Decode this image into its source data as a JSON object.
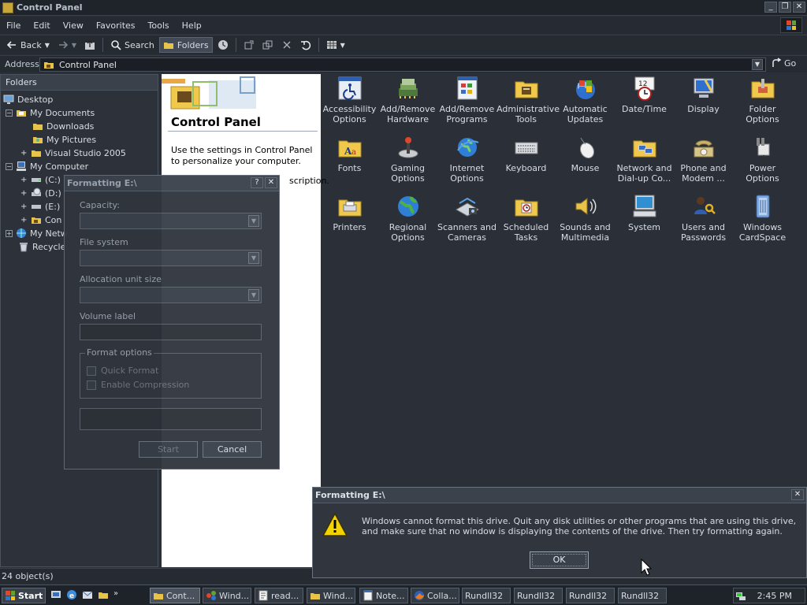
{
  "window": {
    "title": "Control Panel"
  },
  "menu": [
    "File",
    "Edit",
    "View",
    "Favorites",
    "Tools",
    "Help"
  ],
  "toolbar": {
    "back": "Back",
    "search": "Search",
    "folders": "Folders"
  },
  "address": {
    "label": "Address",
    "value": "Control Panel",
    "go": "Go"
  },
  "folders": {
    "header": "Folders",
    "close": "✕",
    "tree": [
      {
        "label": "Desktop"
      },
      {
        "label": "My Documents"
      },
      {
        "label": "Downloads"
      },
      {
        "label": "My Pictures"
      },
      {
        "label": "Visual Studio 2005"
      },
      {
        "label": "My Computer"
      },
      {
        "label": "(C:)"
      },
      {
        "label": "(D:)"
      },
      {
        "label": "(E:)"
      },
      {
        "label": "Con"
      },
      {
        "label": "My Netw"
      },
      {
        "label": "Recycle"
      }
    ]
  },
  "info": {
    "title": "Control Panel",
    "text": "Use the settings in Control Panel to personalize your computer.",
    "text2": "scription."
  },
  "icons": [
    {
      "label": "Accessibility Options"
    },
    {
      "label": "Add/Remove Hardware"
    },
    {
      "label": "Add/Remove Programs"
    },
    {
      "label": "Administrative Tools"
    },
    {
      "label": "Automatic Updates"
    },
    {
      "label": "Date/Time"
    },
    {
      "label": "Display"
    },
    {
      "label": "Folder Options"
    },
    {
      "label": "Fonts"
    },
    {
      "label": "Gaming Options"
    },
    {
      "label": "Internet Options"
    },
    {
      "label": "Keyboard"
    },
    {
      "label": "Mouse"
    },
    {
      "label": "Network and Dial-up Co..."
    },
    {
      "label": "Phone and Modem ..."
    },
    {
      "label": "Power Options"
    },
    {
      "label": "Printers"
    },
    {
      "label": "Regional Options"
    },
    {
      "label": "Scanners and Cameras"
    },
    {
      "label": "Scheduled Tasks"
    },
    {
      "label": "Sounds and Multimedia"
    },
    {
      "label": "System"
    },
    {
      "label": "Users and Passwords"
    },
    {
      "label": "Windows CardSpace"
    }
  ],
  "status": {
    "text": "24 object(s)"
  },
  "format_dialog": {
    "title": "Formatting E:\\",
    "help": "?",
    "close": "✕",
    "capacity_label": "Capacity:",
    "filesystem_label": "File system",
    "allocation_label": "Allocation unit size",
    "volume_label": "Volume label",
    "options_label": "Format options",
    "quick_format": "Quick Format",
    "enable_compression": "Enable Compression",
    "start": "Start",
    "cancel": "Cancel"
  },
  "error_dialog": {
    "title": "Formatting E:\\",
    "close": "✕",
    "message": "Windows cannot format this drive. Quit any disk utilities or other programs that are using this drive, and make sure that no window is displaying the contents of the drive. Then try formatting again.",
    "ok": "OK"
  },
  "taskbar": {
    "start": "Start",
    "tasks": [
      "Cont...",
      "Wind...",
      "read...",
      "Wind...",
      "Note...",
      "Colla...",
      "Rundll32",
      "Rundll32",
      "Rundll32",
      "Rundll32"
    ],
    "clock": "2:45 PM"
  },
  "colors": {
    "accent": "#4a525d",
    "warning": "#f2d200",
    "window_bg": "#2b3038"
  }
}
